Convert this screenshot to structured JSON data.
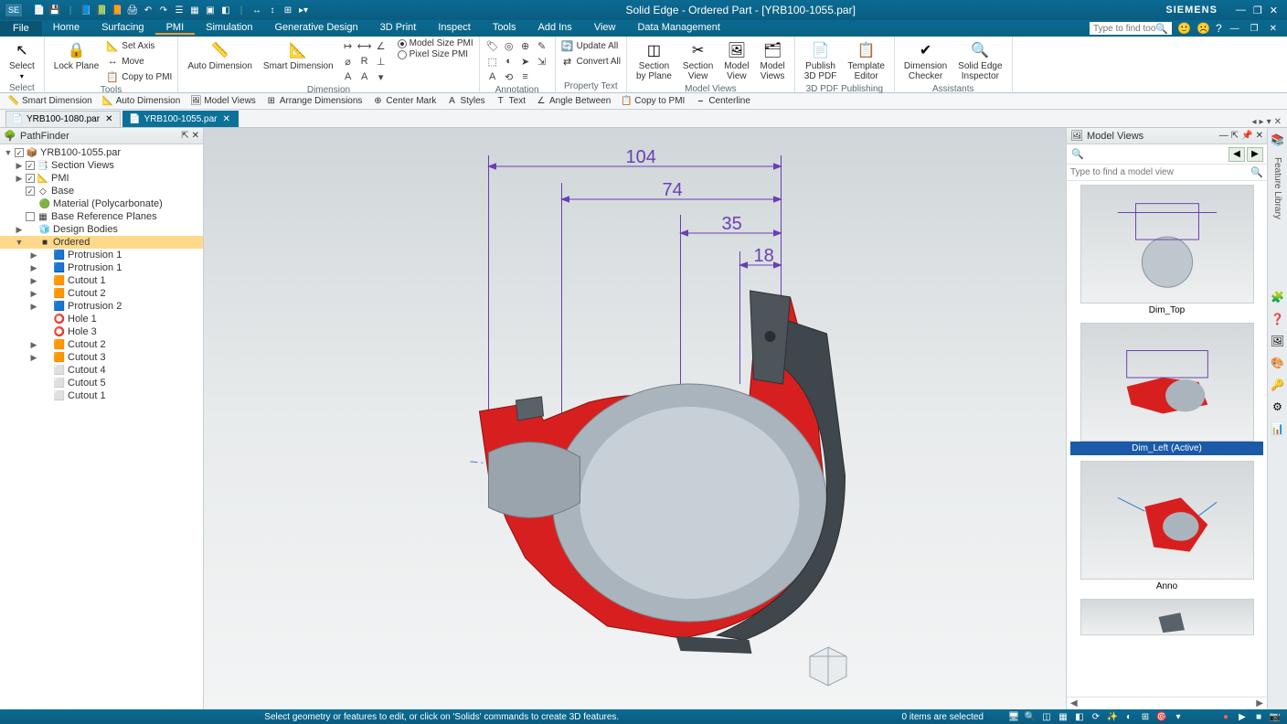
{
  "app": {
    "title": "Solid Edge - Ordered Part - [YRB100-1055.par]",
    "brand": "SIEMENS"
  },
  "menus": {
    "file": "File",
    "items": [
      "Home",
      "Surfacing",
      "PMI",
      "Simulation",
      "Generative Design",
      "3D Print",
      "Inspect",
      "Tools",
      "Add Ins",
      "View",
      "Data Management"
    ],
    "active_index": 2,
    "search_placeholder": "Type to find tools"
  },
  "ribbon": {
    "select": {
      "label": "Select",
      "big": "Select"
    },
    "planes": {
      "label": "Tools",
      "big": "Lock Plane",
      "small": [
        "Set Axis",
        "Move",
        "Copy to PMI"
      ]
    },
    "dim": {
      "label": "Dimension",
      "big1": "Auto Dimension",
      "big2": "Smart Dimension",
      "radio1": "Model Size PMI",
      "radio2": "Pixel Size PMI"
    },
    "annot": {
      "label": "Annotation"
    },
    "proptext": {
      "label": "Property Text",
      "small1": "Update All",
      "small2": "Convert All"
    },
    "mviews": {
      "label": "Model Views",
      "b1a": "Section",
      "b1b": "by Plane",
      "b2a": "Section",
      "b2b": "View",
      "b3a": "Model",
      "b3b": "View",
      "b4a": "Model",
      "b4b": "Views"
    },
    "pdf": {
      "label": "3D PDF Publishing",
      "b1a": "Publish",
      "b1b": "3D PDF",
      "b2a": "Template",
      "b2b": "Editor"
    },
    "assist": {
      "label": "Assistants",
      "b1a": "Dimension",
      "b1b": "Checker",
      "b2a": "Solid Edge",
      "b2b": "Inspector"
    }
  },
  "cmdbar": [
    "Smart Dimension",
    "Auto Dimension",
    "Model Views",
    "Arrange Dimensions",
    "Center Mark",
    "Styles",
    "Text",
    "Angle Between",
    "Copy to PMI",
    "Centerline"
  ],
  "tabs": [
    {
      "name": "YRB100-1080.par",
      "active": false
    },
    {
      "name": "YRB100-1055.par",
      "active": true
    }
  ],
  "pathfinder": {
    "title": "PathFinder",
    "root": "YRB100-1055.par",
    "items": [
      {
        "lvl": 1,
        "exp": "▶",
        "chk": true,
        "ico": "📑",
        "txt": "Section Views"
      },
      {
        "lvl": 1,
        "exp": "▶",
        "chk": true,
        "ico": "📐",
        "txt": "PMI"
      },
      {
        "lvl": 1,
        "exp": "",
        "chk": true,
        "ico": "◇",
        "txt": "Base"
      },
      {
        "lvl": 1,
        "exp": "",
        "chk": null,
        "ico": "🟢",
        "txt": "Material (Polycarbonate)"
      },
      {
        "lvl": 1,
        "exp": "",
        "chk": false,
        "ico": "▦",
        "txt": "Base Reference Planes"
      },
      {
        "lvl": 1,
        "exp": "▶",
        "chk": null,
        "ico": "🧊",
        "txt": "Design Bodies"
      },
      {
        "lvl": 1,
        "exp": "▼",
        "chk": null,
        "ico": "■",
        "txt": "Ordered",
        "sel": true
      },
      {
        "lvl": 2,
        "exp": "▶",
        "chk": null,
        "ico": "🟦",
        "txt": "Protrusion 1"
      },
      {
        "lvl": 2,
        "exp": "▶",
        "chk": null,
        "ico": "🟦",
        "txt": "Protrusion 1"
      },
      {
        "lvl": 2,
        "exp": "▶",
        "chk": null,
        "ico": "🟧",
        "txt": "Cutout 1"
      },
      {
        "lvl": 2,
        "exp": "▶",
        "chk": null,
        "ico": "🟧",
        "txt": "Cutout 2"
      },
      {
        "lvl": 2,
        "exp": "▶",
        "chk": null,
        "ico": "🟦",
        "txt": "Protrusion 2"
      },
      {
        "lvl": 2,
        "exp": "",
        "chk": null,
        "ico": "⭕",
        "txt": "Hole 1"
      },
      {
        "lvl": 2,
        "exp": "",
        "chk": null,
        "ico": "⭕",
        "txt": "Hole 3"
      },
      {
        "lvl": 2,
        "exp": "▶",
        "chk": null,
        "ico": "🟧",
        "txt": "Cutout 2"
      },
      {
        "lvl": 2,
        "exp": "▶",
        "chk": null,
        "ico": "🟧",
        "txt": "Cutout 3"
      },
      {
        "lvl": 2,
        "exp": "",
        "chk": null,
        "ico": "⬜",
        "txt": "Cutout 4"
      },
      {
        "lvl": 2,
        "exp": "",
        "chk": null,
        "ico": "⬜",
        "txt": "Cutout 5"
      },
      {
        "lvl": 2,
        "exp": "",
        "chk": null,
        "ico": "⬜",
        "txt": "Cutout 1"
      }
    ]
  },
  "dims": {
    "d1": "104",
    "d2": "74",
    "d3": "35",
    "d4": "18"
  },
  "modelviews": {
    "title": "Model Views",
    "search_placeholder": "Type to find a model view",
    "items": [
      {
        "label": "Dim_Top",
        "active": false
      },
      {
        "label": "Dim_Left (Active)",
        "active": true
      },
      {
        "label": "Anno",
        "active": false
      }
    ]
  },
  "rightrail_label": "Feature Library",
  "status": {
    "prompt": "Select geometry or features to edit, or click on 'Solids' commands to create 3D features.",
    "selection": "0 items are selected"
  }
}
